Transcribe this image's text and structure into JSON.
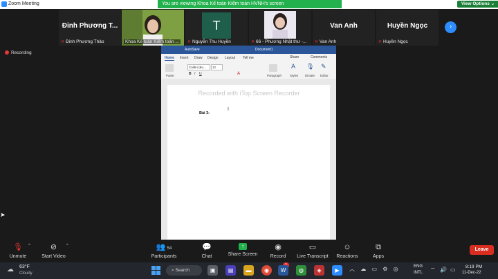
{
  "window": {
    "title": "Zoom Meeting",
    "controls": [
      "–",
      "□",
      "✕"
    ]
  },
  "banner": {
    "message": "You are viewing Khoa Kế toán Kiểm toán HVNH's screen",
    "view_options": "View Options ⌄"
  },
  "gallery": {
    "tiles": [
      {
        "big": "Đinh Phương T...",
        "name": "Đinh Phương Thảo",
        "type": "name"
      },
      {
        "big": "",
        "name": "Khoa Kế toán Kiểm toán ...",
        "type": "video-woman",
        "bg": "#6d8a3a"
      },
      {
        "big": "T",
        "name": "Nguyễn Thu Huyền",
        "type": "letter",
        "bg": "#1f5e4a"
      },
      {
        "big": "",
        "name": "66 - Phương Nhật thư -...",
        "type": "photo-woman",
        "bg": "#ede9f3"
      },
      {
        "big": "Van Anh",
        "name": "Van Anh",
        "type": "name"
      },
      {
        "big": "Huyền Ngọc",
        "name": "Huyền Ngọc",
        "type": "name"
      }
    ]
  },
  "recording_label": "Recording",
  "word": {
    "autosave": "AutoSave",
    "doc_title": "Document1",
    "tabs": [
      "Home",
      "Insert",
      "Draw",
      "Design",
      "Layout",
      "Tell me"
    ],
    "share": "Share",
    "comments": "Comments",
    "font_name": "Calibri (Bo...",
    "font_size": "12",
    "paste_label": "Paste",
    "paragraph_label": "Paragraph",
    "styles_label": "Styles",
    "dictate_label": "Dictate",
    "editor_label": "Editor",
    "body_text": "Bài 3:"
  },
  "watermark": "Recorded with iTop Screen Recorder",
  "toolbar": {
    "unmute": "Unmute",
    "start_video": "Start Video",
    "participants": "Participants",
    "participants_count": "54",
    "chat": "Chat",
    "share_screen": "Share Screen",
    "record": "Record",
    "live_transcript": "Live Transcript",
    "reactions": "Reactions",
    "apps": "Apps",
    "leave": "Leave"
  },
  "taskbar": {
    "temperature": "63°F",
    "condition": "Cloudy",
    "search": "Search",
    "lang_top": "ENG",
    "lang_bottom": "INTL",
    "time": "8:19 PM",
    "date": "11-Dec-22",
    "notification_count": "1"
  },
  "colors": {
    "zoom_blue": "#2d8cff",
    "banner_green": "#23b14d",
    "leave_red": "#d92d20",
    "word_blue": "#2b579a"
  }
}
